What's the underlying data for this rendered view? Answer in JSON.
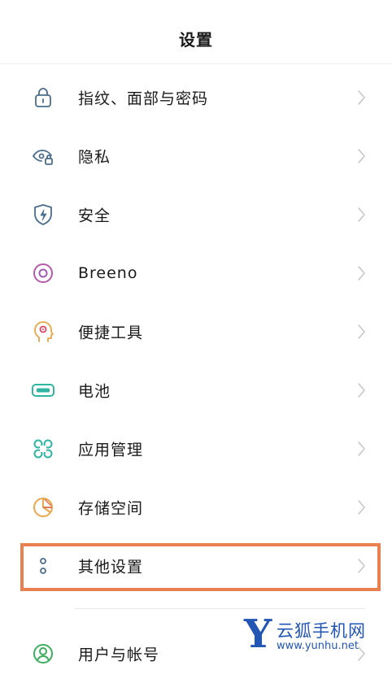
{
  "header": {
    "title": "设置"
  },
  "items": [
    {
      "label": "指纹、面部与密码",
      "icon": "lock-icon",
      "color": "#4a6d8c"
    },
    {
      "label": "隐私",
      "icon": "eye-lock-icon",
      "color": "#4a6d8c"
    },
    {
      "label": "安全",
      "icon": "shield-icon",
      "color": "#4a6d8c"
    },
    {
      "label": "Breeno",
      "icon": "breeno-icon",
      "color": "#b45aa8"
    },
    {
      "label": "便捷工具",
      "icon": "head-icon",
      "color": "#e9a64a"
    },
    {
      "label": "电池",
      "icon": "battery-icon",
      "color": "#2fb5a2"
    },
    {
      "label": "应用管理",
      "icon": "apps-icon",
      "color": "#2fb5a2"
    },
    {
      "label": "存储空间",
      "icon": "pie-chart-icon",
      "color": "#e9a64a"
    },
    {
      "label": "其他设置",
      "icon": "more-icon",
      "color": "#4a6d8c"
    },
    {
      "label": "用户与帐号",
      "icon": "user-icon",
      "color": "#3cae5e"
    }
  ],
  "highlight_color": "#e8804f",
  "watermark": {
    "logo": "Y",
    "name": "云狐手机网",
    "url": "www.yunhu.net"
  }
}
